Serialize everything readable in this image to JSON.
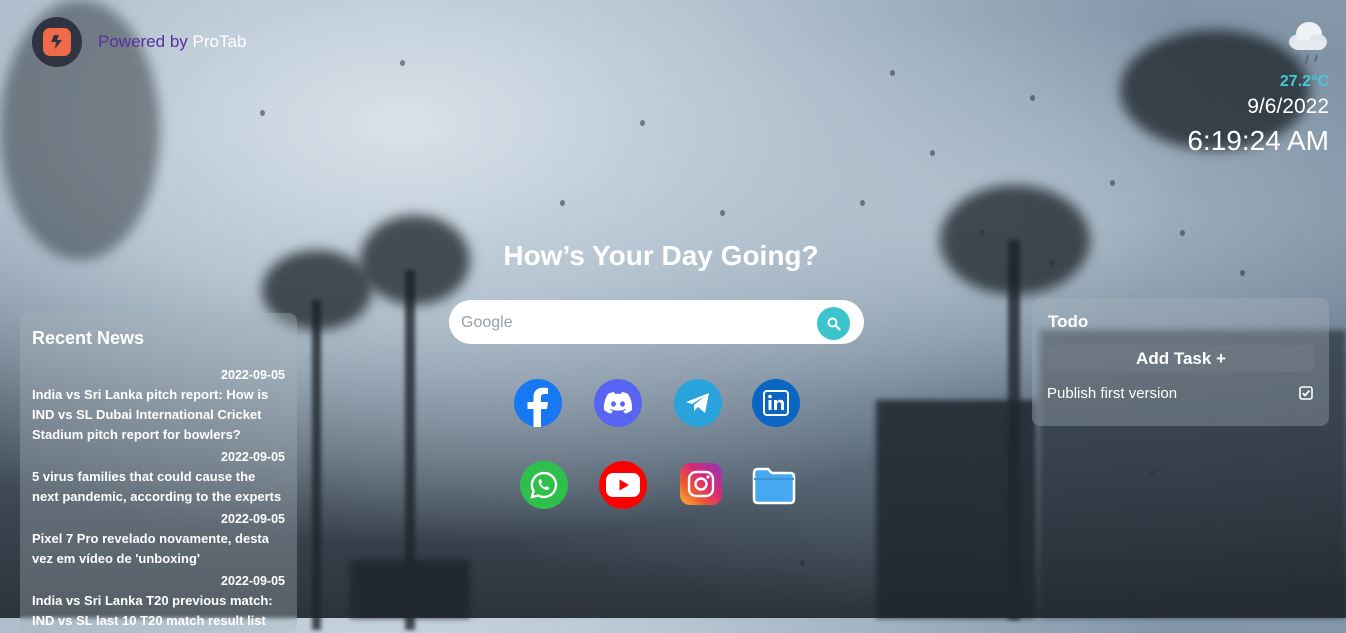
{
  "brand": {
    "powered_by": "Powered by",
    "name": "ProTab",
    "logo_icon": "bolt-icon"
  },
  "weather": {
    "icon": "rain-cloud-icon",
    "temperature": "27.2°C",
    "date": "9/6/2022",
    "time": "6:19:24 AM"
  },
  "headline": "How’s Your Day Going?",
  "search": {
    "placeholder": "Google",
    "value": "",
    "button_icon": "search-icon"
  },
  "shortcuts": [
    {
      "name": "facebook",
      "icon": "facebook-icon",
      "color": "#1877f2"
    },
    {
      "name": "discord",
      "icon": "discord-icon",
      "color": "#5865f2"
    },
    {
      "name": "telegram",
      "icon": "telegram-icon",
      "color": "#2aa3dd"
    },
    {
      "name": "linkedin",
      "icon": "linkedin-icon",
      "color": "#0a66c2"
    },
    {
      "name": "whatsapp",
      "icon": "whatsapp-icon",
      "color": "#2fbf4b"
    },
    {
      "name": "youtube",
      "icon": "youtube-icon",
      "color": "#ff0000"
    },
    {
      "name": "instagram",
      "icon": "instagram-icon",
      "color": "#d6287b"
    },
    {
      "name": "folder",
      "icon": "folder-icon",
      "color": "#46a9f0"
    }
  ],
  "news": {
    "title": "Recent News",
    "items": [
      {
        "date": "2022-09-05",
        "title": "India vs Sri Lanka pitch report: How is IND vs SL Dubai International Cricket Stadium pitch report for bowlers?"
      },
      {
        "date": "2022-09-05",
        "title": "5 virus families that could cause the next pandemic, according to the experts"
      },
      {
        "date": "2022-09-05",
        "title": "Pixel 7 Pro revelado novamente, desta vez em vídeo de 'unboxing'"
      },
      {
        "date": "2022-09-05",
        "title": "India vs Sri Lanka T20 previous match: IND vs SL last 10 T20 match result list"
      }
    ]
  },
  "todo": {
    "title": "Todo",
    "add_label": "Add Task +",
    "tasks": [
      {
        "text": "Publish first version",
        "done": true
      }
    ]
  },
  "colors": {
    "accent": "#3cc4cc",
    "temperature": "#41cad8",
    "brand_purple": "#5a2f9e"
  }
}
